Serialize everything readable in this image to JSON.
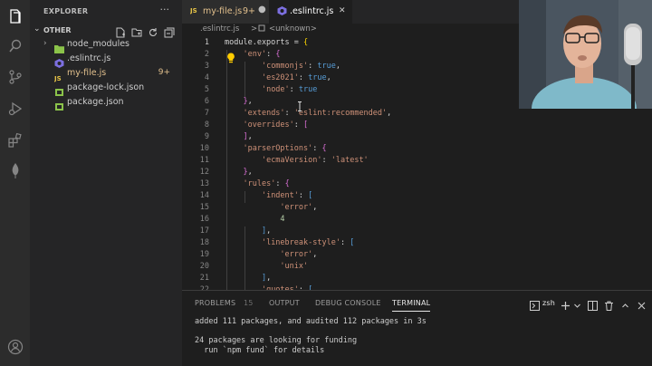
{
  "sidebar": {
    "title": "EXPLORER",
    "more": "···",
    "section": "OTHER",
    "items": [
      {
        "label": "node_modules",
        "badge": ""
      },
      {
        "label": ".eslintrc.js",
        "badge": ""
      },
      {
        "label": "my-file.js",
        "badge": "9+"
      },
      {
        "label": "package-lock.json",
        "badge": ""
      },
      {
        "label": "package.json",
        "badge": ""
      }
    ]
  },
  "tabs": [
    {
      "label": "my-file.js",
      "badge": "9+"
    },
    {
      "label": ".eslintrc.js",
      "close": "✕"
    }
  ],
  "breadcrumb": {
    "file": ".eslintrc.js",
    "sep": ">",
    "symbol": "<unknown>"
  },
  "editor": {
    "line_numbers": [
      "1",
      "2",
      "3",
      "4",
      "5",
      "6",
      "7",
      "8",
      "9",
      "10",
      "11",
      "12",
      "13",
      "14",
      "15",
      "16",
      "17",
      "18",
      "19",
      "20",
      "21",
      "22"
    ]
  },
  "panel": {
    "tabs": {
      "problems": "PROBLEMS",
      "problems_count": "15",
      "output": "OUTPUT",
      "debug": "DEBUG CONSOLE",
      "terminal": "TERMINAL"
    },
    "shell": "zsh",
    "terminal_lines": [
      "added 111 packages, and audited 112 packages in 3s",
      "",
      "24 packages are looking for funding",
      "  run `npm fund` for details",
      ""
    ]
  },
  "colors": {
    "accent": "#007acc",
    "modified": "#e2c08d",
    "string": "#ce9178"
  }
}
